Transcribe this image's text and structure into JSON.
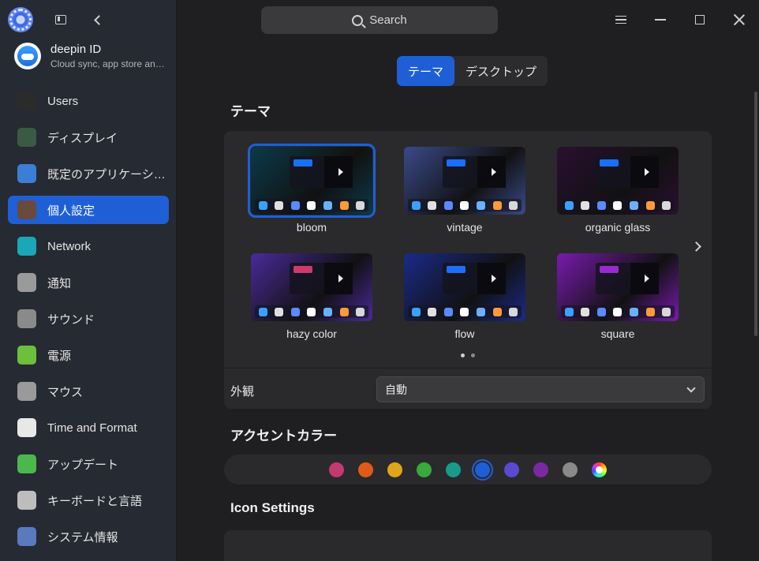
{
  "search": {
    "label": "Search"
  },
  "account": {
    "name": "deepin ID",
    "subtitle": "Cloud sync, app store an…"
  },
  "sidebar": {
    "items": [
      {
        "label": "Users",
        "icon": "user-icon",
        "color": "#2b2b2b"
      },
      {
        "label": "ディスプレイ",
        "icon": "display-icon",
        "color": "#3a5a44"
      },
      {
        "label": "既定のアプリケーシ…",
        "icon": "default-apps-icon",
        "color": "#3a7fd5"
      },
      {
        "label": "個人設定",
        "icon": "personalization-icon",
        "color": "#6a4a3a",
        "active": true
      },
      {
        "label": "Network",
        "icon": "network-icon",
        "color": "#1aa7b8"
      },
      {
        "label": "通知",
        "icon": "notification-bell-icon",
        "color": "#9a9a9a"
      },
      {
        "label": "サウンド",
        "icon": "speaker-icon",
        "color": "#8a8a8a"
      },
      {
        "label": "電源",
        "icon": "battery-icon",
        "color": "#6cc03a"
      },
      {
        "label": "マウス",
        "icon": "mouse-icon",
        "color": "#9a9a9a"
      },
      {
        "label": "Time and Format",
        "icon": "clock-icon",
        "color": "#e8e8e8"
      },
      {
        "label": "アップデート",
        "icon": "update-icon",
        "color": "#4cb84c"
      },
      {
        "label": "キーボードと言語",
        "icon": "keyboard-icon",
        "color": "#bdbdbd"
      },
      {
        "label": "システム情報",
        "icon": "system-info-icon",
        "color": "#5a7ac0"
      }
    ]
  },
  "tabs": [
    {
      "label": "テーマ",
      "active": true
    },
    {
      "label": "デスクトップ",
      "active": false
    }
  ],
  "theme_section": {
    "title": "テーマ",
    "themes": [
      {
        "name": "bloom",
        "selected": true,
        "bg": "#0b3a4a",
        "accent": "#1a6fff"
      },
      {
        "name": "vintage",
        "selected": false,
        "bg": "#3a4a8a",
        "accent": "#1a6fff"
      },
      {
        "name": "organic glass",
        "selected": false,
        "bg": "#2a1030",
        "accent": "#1a6fff"
      },
      {
        "name": "hazy color",
        "selected": false,
        "bg": "#4a2a9a",
        "accent": "#d03a6a"
      },
      {
        "name": "flow",
        "selected": false,
        "bg": "#1a2a8a",
        "accent": "#1a6fff"
      },
      {
        "name": "square",
        "selected": false,
        "bg": "#7a1ab0",
        "accent": "#9a2ad0"
      }
    ],
    "page_index": 1,
    "page_count": 2
  },
  "appearance": {
    "label": "外観",
    "value": "自動"
  },
  "accent_section": {
    "title": "アクセントカラー",
    "colors": [
      "#c33a72",
      "#e05a1a",
      "#e0a51a",
      "#3aa83a",
      "#1a9a8a",
      "#1f5fd6",
      "#5a4ad0",
      "#7a2aa0",
      "#8a8a8a",
      "multicolor"
    ],
    "selected_index": 5
  },
  "icon_section": {
    "title": "Icon Settings"
  }
}
